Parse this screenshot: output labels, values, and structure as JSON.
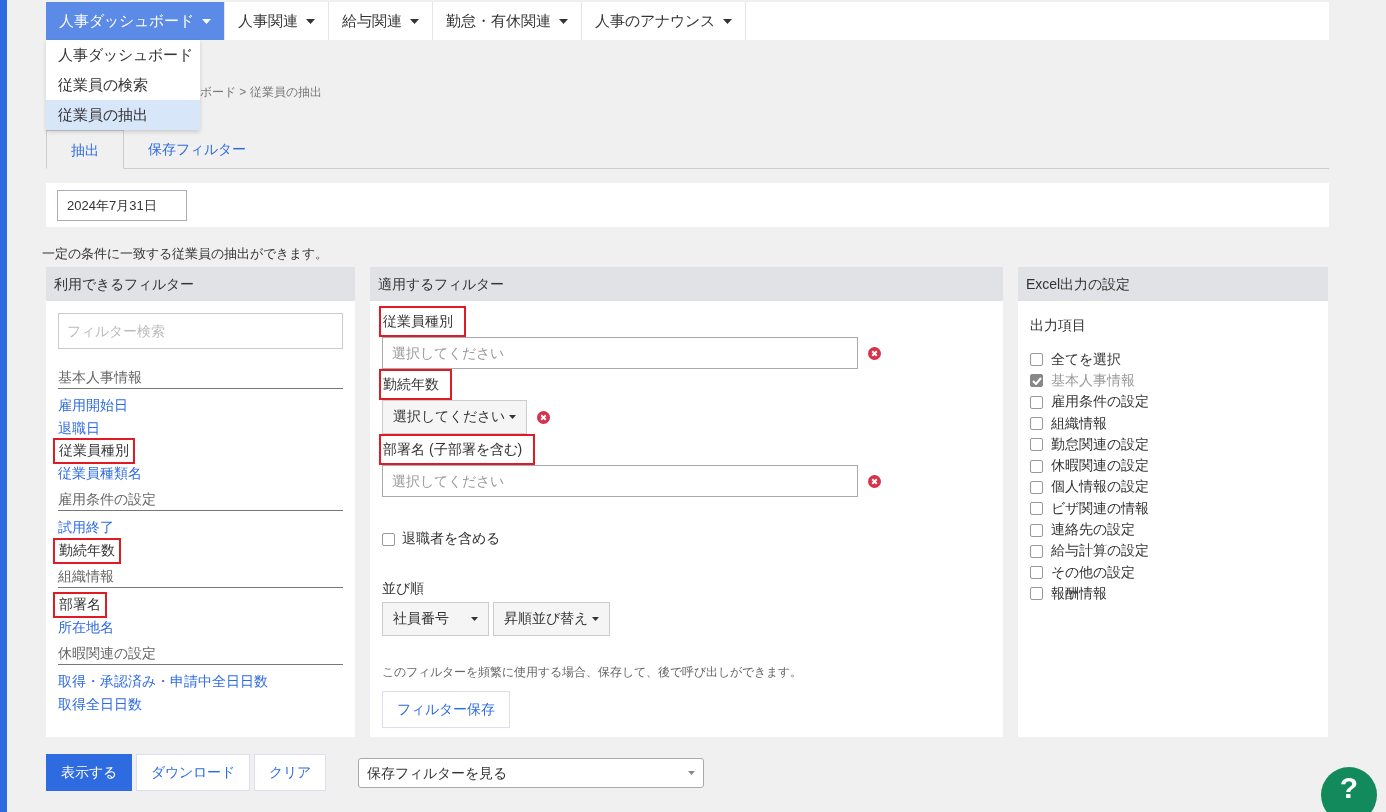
{
  "nav": [
    {
      "label": "人事ダッシュボード",
      "selected": true
    },
    {
      "label": "人事関連",
      "selected": false
    },
    {
      "label": "給与関連",
      "selected": false
    },
    {
      "label": "勤怠・有休関連",
      "selected": false
    },
    {
      "label": "人事のアナウンス",
      "selected": false
    }
  ],
  "dropdown": [
    {
      "label": "人事ダッシュボード",
      "selected": false
    },
    {
      "label": "従業員の検索",
      "selected": false
    },
    {
      "label": "従業員の抽出",
      "selected": true
    }
  ],
  "breadcrumb": "ボード > 従業員の抽出",
  "tabs": [
    {
      "label": "抽出",
      "selected": true
    },
    {
      "label": "保存フィルター",
      "selected": false
    }
  ],
  "date": "2024年7月31日",
  "description": "一定の条件に一致する従業員の抽出ができます。",
  "available": {
    "title": "利用できるフィルター",
    "search_placeholder": "フィルター検索",
    "groups": [
      {
        "heading": "基本人事情報",
        "items": [
          {
            "label": "雇用開始日",
            "highlighted": false
          },
          {
            "label": "退職日",
            "highlighted": false
          },
          {
            "label": "従業員種別",
            "highlighted": true
          },
          {
            "label": "従業員種類名",
            "highlighted": false
          }
        ]
      },
      {
        "heading": "雇用条件の設定",
        "items": [
          {
            "label": "試用終了",
            "highlighted": false
          },
          {
            "label": "勤続年数",
            "highlighted": true
          }
        ]
      },
      {
        "heading": "組織情報",
        "items": [
          {
            "label": "部署名",
            "highlighted": true
          },
          {
            "label": "所在地名",
            "highlighted": false
          }
        ]
      },
      {
        "heading": "休暇関連の設定",
        "items": [
          {
            "label": "取得・承認済み・申請中全日日数",
            "highlighted": false
          },
          {
            "label": "取得全日日数",
            "highlighted": false
          }
        ]
      }
    ]
  },
  "applied": {
    "title": "適用するフィルター",
    "filters": [
      {
        "label": "従業員種別",
        "kind": "multiselect",
        "placeholder": "選択してください",
        "highlighted": true
      },
      {
        "label": "勤続年数",
        "kind": "dropdown",
        "value": "選択してください",
        "highlighted": true
      },
      {
        "label": "部署名 (子部署を含む)",
        "kind": "multiselect",
        "placeholder": "選択してください",
        "highlighted": true
      }
    ],
    "include_retired": {
      "label": "退職者を含める",
      "checked": false
    },
    "sort_label": "並び順",
    "sort_field": "社員番号",
    "sort_order": "昇順並び替え",
    "save_hint": "このフィルターを頻繁に使用する場合、保存して、後で呼び出しができます。",
    "save_button": "フィルター保存"
  },
  "excel": {
    "title": "Excel出力の設定",
    "subtitle": "出力項目",
    "options": [
      {
        "label": "全てを選択",
        "checked": false,
        "disabled": false
      },
      {
        "label": "基本人事情報",
        "checked": true,
        "disabled": true
      },
      {
        "label": "雇用条件の設定",
        "checked": false,
        "disabled": false
      },
      {
        "label": "組織情報",
        "checked": false,
        "disabled": false
      },
      {
        "label": "勤怠関連の設定",
        "checked": false,
        "disabled": false
      },
      {
        "label": "休暇関連の設定",
        "checked": false,
        "disabled": false
      },
      {
        "label": "個人情報の設定",
        "checked": false,
        "disabled": false
      },
      {
        "label": "ビザ関連の情報",
        "checked": false,
        "disabled": false
      },
      {
        "label": "連絡先の設定",
        "checked": false,
        "disabled": false
      },
      {
        "label": "給与計算の設定",
        "checked": false,
        "disabled": false
      },
      {
        "label": "その他の設定",
        "checked": false,
        "disabled": false
      },
      {
        "label": "報酬情報",
        "checked": false,
        "disabled": false
      }
    ]
  },
  "actions": [
    {
      "label": "表示する",
      "kind": "primary"
    },
    {
      "label": "ダウンロード",
      "kind": "default"
    },
    {
      "label": "クリア",
      "kind": "default"
    }
  ],
  "saved_filter_select": "保存フィルターを見る",
  "help": "?"
}
